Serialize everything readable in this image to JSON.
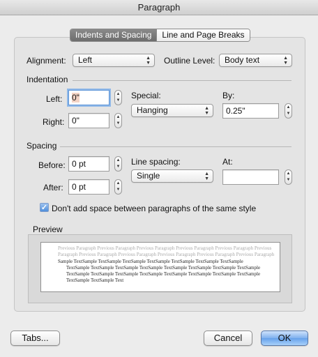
{
  "window": {
    "title": "Paragraph"
  },
  "tabs": [
    {
      "label": "Indents and Spacing",
      "active": true
    },
    {
      "label": "Line and Page Breaks",
      "active": false
    }
  ],
  "general": {
    "alignment_label": "Alignment:",
    "alignment_value": "Left",
    "outline_label": "Outline Level:",
    "outline_value": "Body text"
  },
  "indentation": {
    "title": "Indentation",
    "left_label": "Left:",
    "left_value": "0\"",
    "right_label": "Right:",
    "right_value": "0\"",
    "special_label": "Special:",
    "special_value": "Hanging",
    "by_label": "By:",
    "by_value": "0.25\""
  },
  "spacing": {
    "title": "Spacing",
    "before_label": "Before:",
    "before_value": "0 pt",
    "after_label": "After:",
    "after_value": "0 pt",
    "line_spacing_label": "Line spacing:",
    "line_spacing_value": "Single",
    "at_label": "At:",
    "at_value": "",
    "dont_add_space_label": "Don't add space between paragraphs of the same style",
    "dont_add_space_checked": true
  },
  "preview": {
    "title": "Preview",
    "previous_text": "Previous Paragraph Previous Paragraph Previous Paragraph Previous Paragraph Previous Paragraph Previous Paragraph Previous Paragraph Previous Paragraph Previous Paragraph Previous Paragraph Previous Paragraph",
    "sample_first": "Sample TextSample TextSample TextSample TextSample TextSample TextSample TextSample",
    "sample_rest": "TextSample TextSample TextSample TextSample TextSample TextSample TextSample TextSample TextSample TextSample TextSample TextSample TextSample TextSample TextSample TextSample TextSample TextSample Text"
  },
  "buttons": {
    "tabs_label": "Tabs...",
    "cancel_label": "Cancel",
    "ok_label": "OK"
  },
  "colors": {
    "accent": "#66a1ea",
    "focus_ring": "#8fb8e8",
    "tab_active": "#6d6d6d"
  }
}
